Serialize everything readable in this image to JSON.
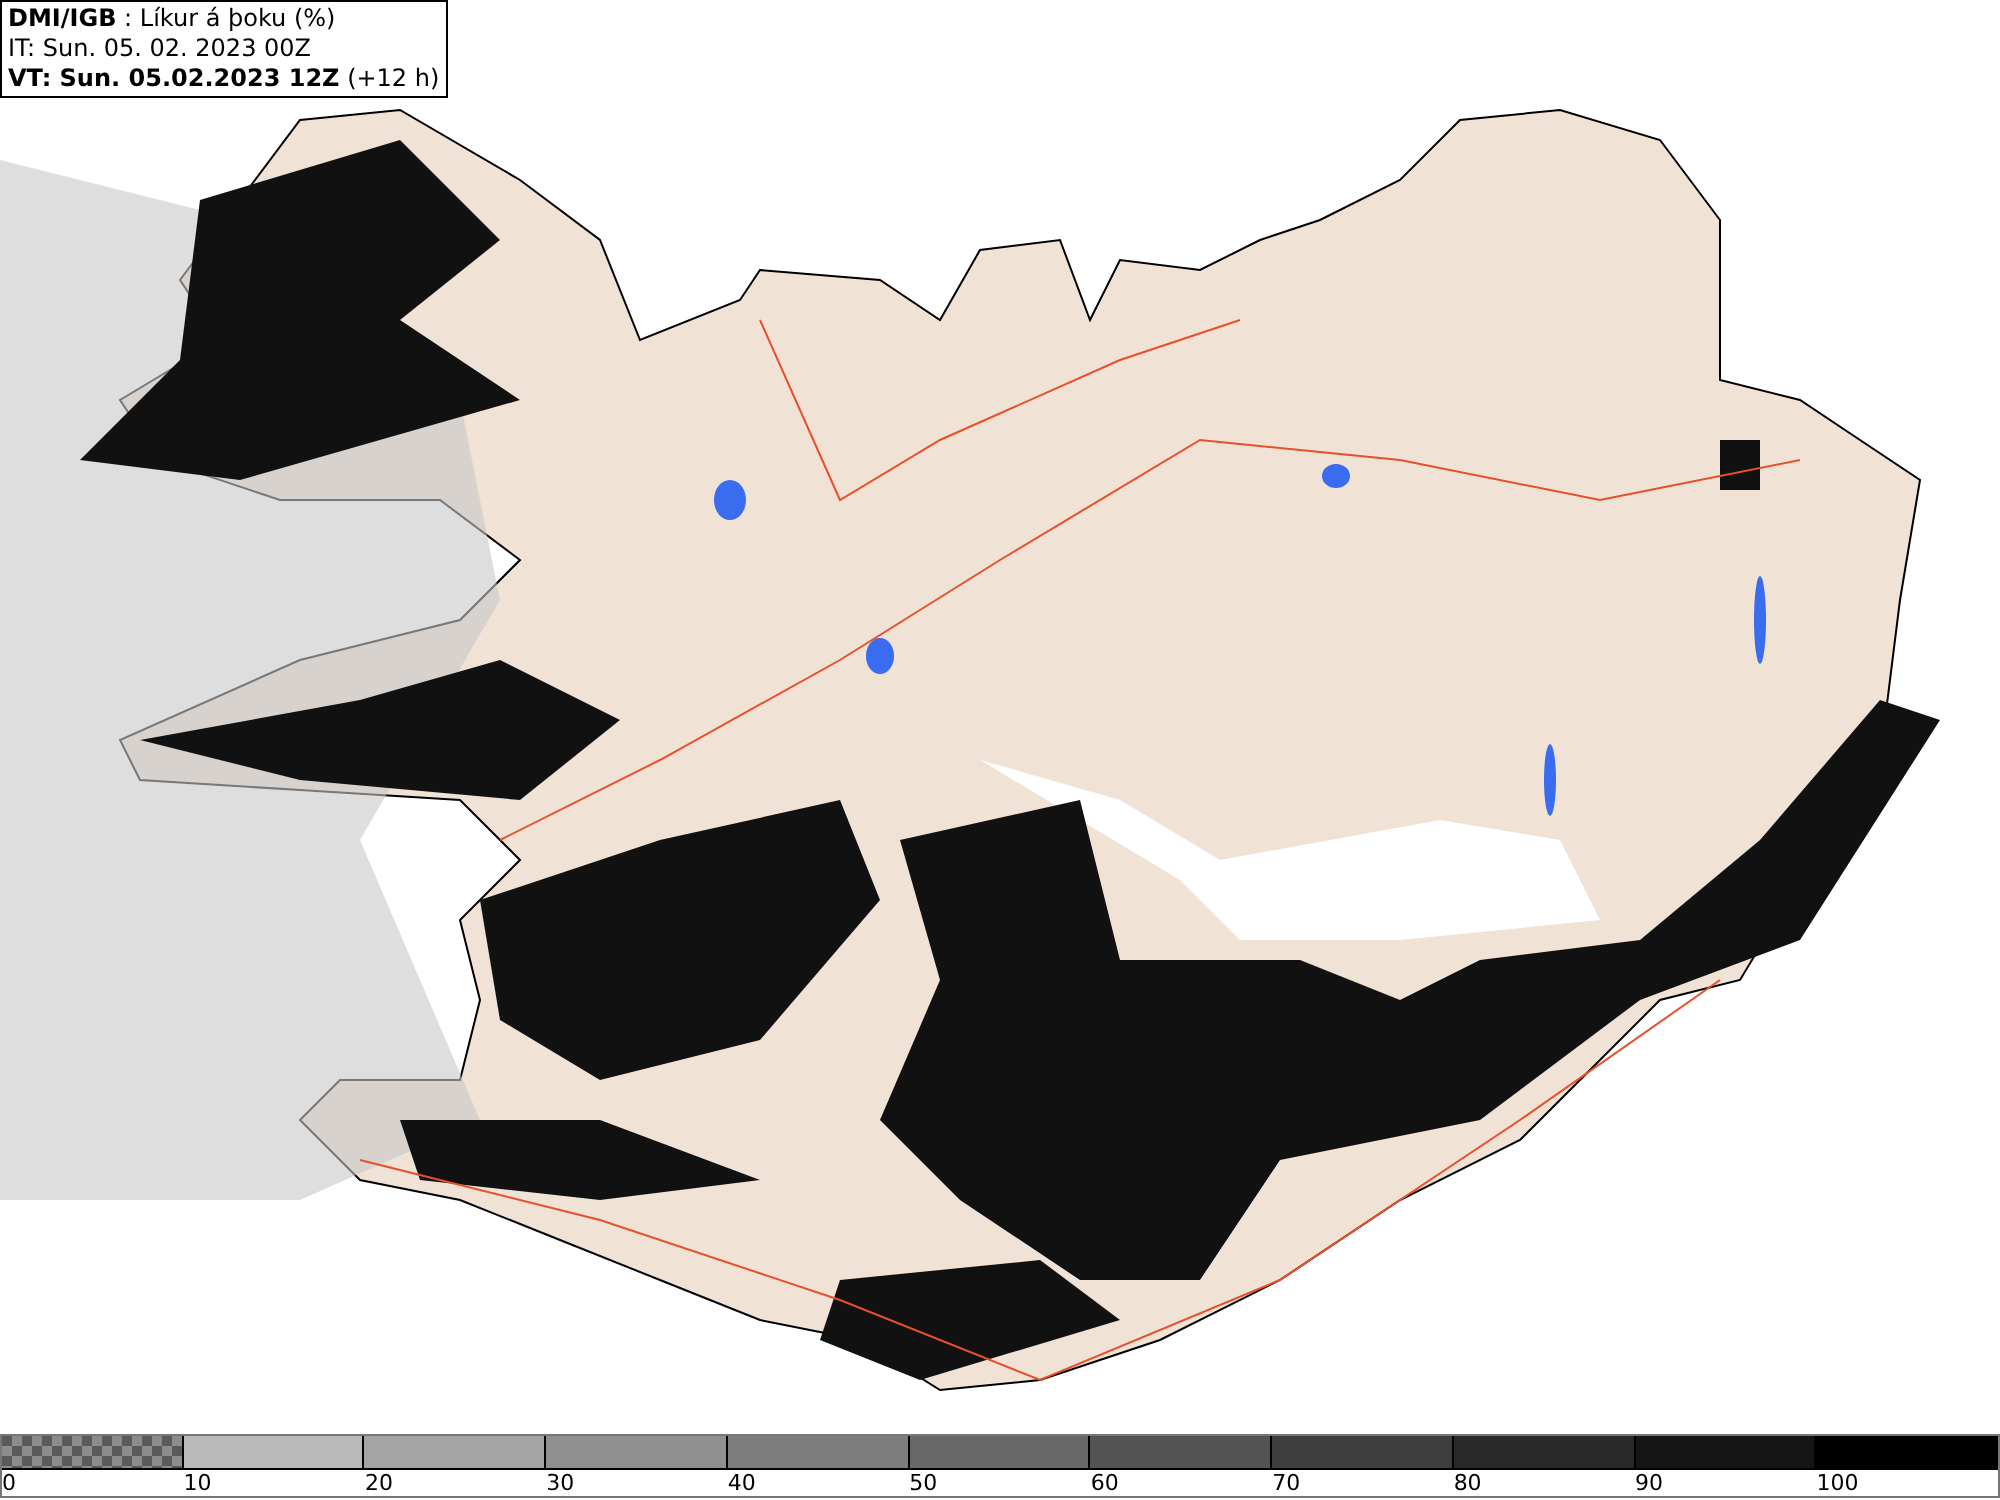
{
  "header": {
    "title": "**DMI/IGB** : Líkur á þoku (%)",
    "initial_time": "IT: Sun. 05. 02. 2023 00Z",
    "valid_time": "**VT: Sun. 05.02.2023 12Z** (+12 h)"
  },
  "legend": {
    "swatches": [
      {
        "kind": "checker",
        "color": "#8c8c8c"
      },
      {
        "kind": "solid",
        "color": "#b9b9b9"
      },
      {
        "kind": "solid",
        "color": "#a4a4a4"
      },
      {
        "kind": "solid",
        "color": "#909090"
      },
      {
        "kind": "solid",
        "color": "#7d7d7d"
      },
      {
        "kind": "solid",
        "color": "#686868"
      },
      {
        "kind": "solid",
        "color": "#535353"
      },
      {
        "kind": "solid",
        "color": "#3e3e3e"
      },
      {
        "kind": "solid",
        "color": "#292929"
      },
      {
        "kind": "solid",
        "color": "#151515"
      },
      {
        "kind": "solid",
        "color": "#000000"
      }
    ],
    "labels": [
      "0",
      "10",
      "20",
      "30",
      "40",
      "50",
      "60",
      "70",
      "80",
      "90",
      "100"
    ]
  }
}
